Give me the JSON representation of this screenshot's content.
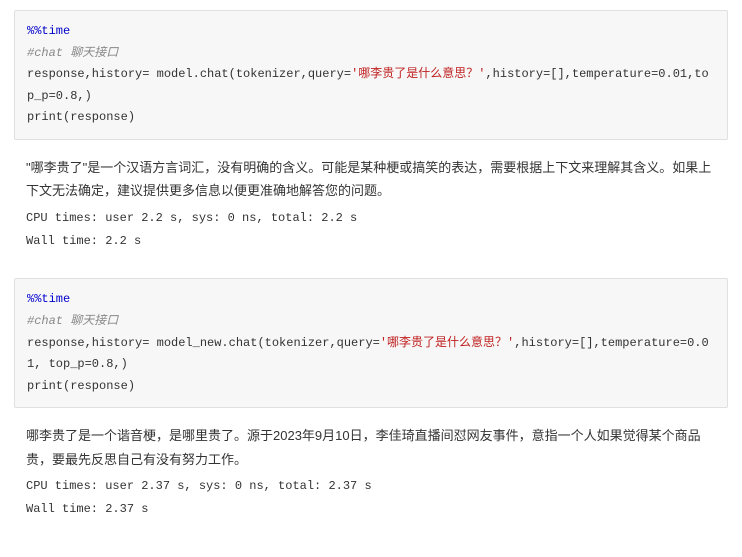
{
  "cell1": {
    "magic": "%%time",
    "comment": "#chat 聊天接口",
    "line1a": "response,history= model.chat(tokenizer,query=",
    "str": "'哪李贵了是什么意思？'",
    "line1b": ",history=[],temperature=0.01,top_p=0.8,)",
    "line2": "print(response)"
  },
  "out1": {
    "text": "\"哪李贵了\"是一个汉语方言词汇，没有明确的含义。可能是某种梗或搞笑的表达，需要根据上下文来理解其含义。如果上下文无法确定，建议提供更多信息以便更准确地解答您的问题。",
    "cpu": "CPU times: user 2.2 s, sys: 0 ns, total: 2.2 s",
    "wall": "Wall time: 2.2 s"
  },
  "cell2": {
    "magic": "%%time",
    "comment": "#chat 聊天接口",
    "line1a": "response,history= model_new.chat(tokenizer,query=",
    "str": "'哪李贵了是什么意思？'",
    "line1b": ",history=[],temperature=0.01, top_p=0.8,)",
    "line2": "print(response)"
  },
  "out2": {
    "text": "哪李贵了是一个谐音梗，是哪里贵了。源于2023年9月10日，李佳琦直播间怼网友事件，意指一个人如果觉得某个商品贵，要最先反思自己有没有努力工作。",
    "cpu": "CPU times: user 2.37 s, sys: 0 ns, total: 2.37 s",
    "wall": "Wall time: 2.37 s"
  }
}
